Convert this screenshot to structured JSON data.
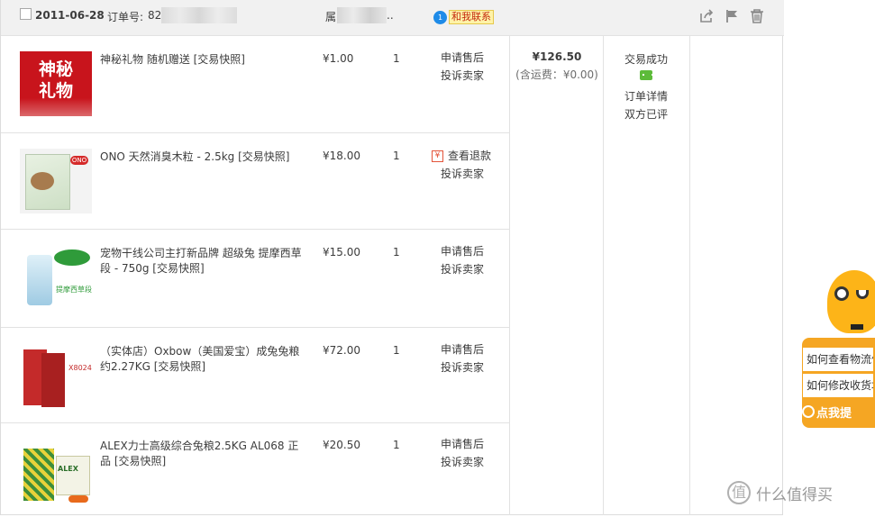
{
  "order": {
    "date": "2011-06-28",
    "order_no_label": "订单号:",
    "order_no_visible": "82",
    "seller_label": "属",
    "seller_suffix": "..",
    "contact_label": "和我联系",
    "contact_badge": "1",
    "total": "¥126.50",
    "shipping": "(含运费：¥0.00)",
    "status": "交易成功",
    "detail_link": "订单详情",
    "rated": "双方已评",
    "header_icons": [
      "share-icon",
      "flag-icon",
      "trash-icon"
    ]
  },
  "items": [
    {
      "title": "神秘礼物 随机赠送 [交易快照]",
      "price": "¥1.00",
      "qty": "1",
      "svc1": "申请售后",
      "svc2": "投诉卖家",
      "thumb_text": "神秘\n礼物"
    },
    {
      "title": "ONO 天然消臭木粒 - 2.5kg [交易快照]",
      "price": "¥18.00",
      "qty": "1",
      "svc1": "查看退款",
      "svc2": "投诉卖家",
      "refund_icon": "¥",
      "thumb_text": "ONO"
    },
    {
      "title": "宠物干线公司主打新品牌 超级兔 提摩西草段 - 750g [交易快照]",
      "price": "¥15.00",
      "qty": "1",
      "svc1": "申请售后",
      "svc2": "投诉卖家",
      "thumb_text": "提摩西草段"
    },
    {
      "title": "（实体店）Oxbow（美国爱宝）成兔兔粮约2.27KG [交易快照]",
      "price": "¥72.00",
      "qty": "1",
      "svc1": "申请售后",
      "svc2": "投诉卖家",
      "thumb_text": "X8024"
    },
    {
      "title": "ALEX力士高级综合兔粮2.5KG AL068 正品 [交易快照]",
      "price": "¥20.50",
      "qty": "1",
      "svc1": "申请售后",
      "svc2": "投诉卖家",
      "thumb_text": "ALEX"
    }
  ],
  "assistant": {
    "q1": "如何查看物流信",
    "q2": "如何修改收货地",
    "ask": "点我提"
  },
  "watermark": "什么值得买",
  "colors": {
    "header_bg": "#f1f1f1",
    "border": "#e2e2e2",
    "contact_bg": "#fff3a8",
    "contact_text": "#c4280c",
    "assistant": "#f5a623",
    "refund": "#e4543a"
  }
}
